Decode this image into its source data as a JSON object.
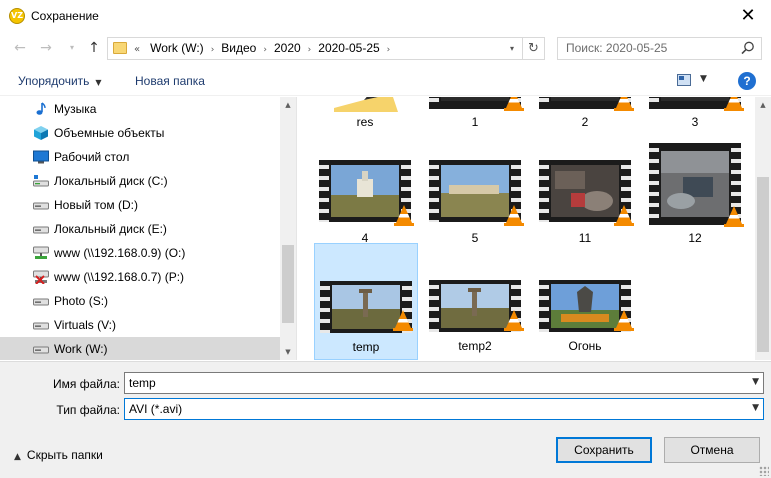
{
  "window": {
    "title": "Сохранение",
    "app_icon_text": "VZ",
    "close_glyph": "✕"
  },
  "nav": {
    "back_glyph": "←",
    "forward_glyph": "→",
    "dropdown_glyph": "▾",
    "up_glyph": "↑",
    "lead_glyph": "«",
    "breadcrumb": [
      "Work (W:)",
      "Видео",
      "2020",
      "2020-05-25"
    ],
    "refresh_glyph": "↻",
    "search_placeholder": "Поиск: 2020-05-25"
  },
  "toolbar": {
    "organize_label": "Упорядочить",
    "new_folder_label": "Новая папка",
    "help_glyph": "?"
  },
  "sidebar": {
    "items": [
      {
        "label": "Музыка",
        "icon": "music-icon"
      },
      {
        "label": "Объемные объекты",
        "icon": "3d-objects-icon"
      },
      {
        "label": "Рабочий стол",
        "icon": "desktop-icon"
      },
      {
        "label": "Локальный диск (C:)",
        "icon": "system-drive-icon"
      },
      {
        "label": "Новый том (D:)",
        "icon": "drive-icon"
      },
      {
        "label": "Локальный диск (E:)",
        "icon": "drive-icon"
      },
      {
        "label": "www (\\\\192.168.0.9) (O:)",
        "icon": "network-drive-icon"
      },
      {
        "label": "www (\\\\192.168.0.7) (P:)",
        "icon": "network-drive-disconnected-icon"
      },
      {
        "label": "Photo (S:)",
        "icon": "drive-icon"
      },
      {
        "label": "Virtuals (V:)",
        "icon": "drive-icon"
      },
      {
        "label": "Work (W:)",
        "icon": "drive-icon",
        "selected": true
      }
    ]
  },
  "files": {
    "items": [
      {
        "label": "res",
        "kind": "folder"
      },
      {
        "label": "1",
        "kind": "video"
      },
      {
        "label": "2",
        "kind": "video"
      },
      {
        "label": "3",
        "kind": "video"
      },
      {
        "label": "4",
        "kind": "video"
      },
      {
        "label": "5",
        "kind": "video"
      },
      {
        "label": "11",
        "kind": "video"
      },
      {
        "label": "12",
        "kind": "video"
      },
      {
        "label": "temp",
        "kind": "video",
        "selected": true
      },
      {
        "label": "temp2",
        "kind": "video"
      },
      {
        "label": "Огонь",
        "kind": "video"
      }
    ]
  },
  "form": {
    "filename_label": "Имя файла:",
    "filename_value": "temp",
    "filetype_label": "Тип файла:",
    "filetype_value": "AVI (*.avi)"
  },
  "footer": {
    "hide_folders_label": "Скрыть папки",
    "save_label": "Сохранить",
    "cancel_label": "Отмена"
  },
  "colors": {
    "accent": "#0078d7",
    "selection_bg": "#cce8ff",
    "selection_border": "#99d1ff",
    "sidebar_selected": "#d9d9d9",
    "link_blue": "#1e3b6e"
  }
}
